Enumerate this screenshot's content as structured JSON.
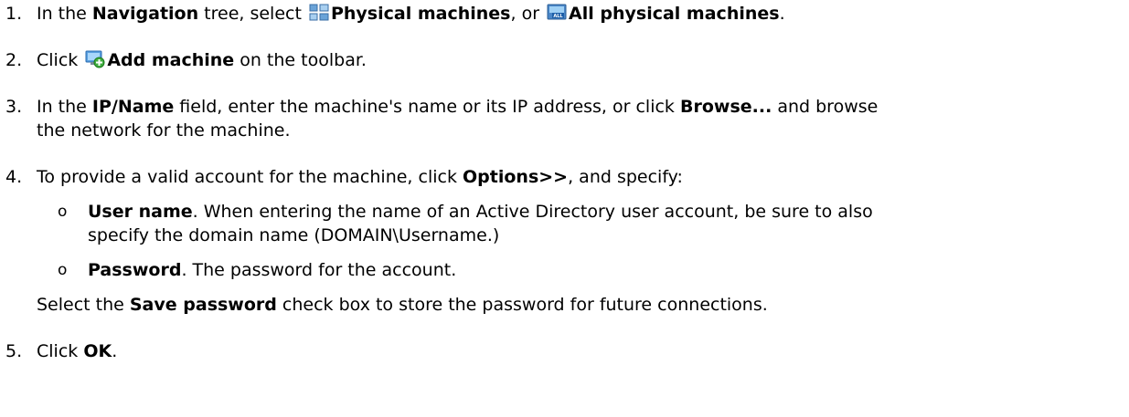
{
  "steps": [
    {
      "num": "1.",
      "p1": "In the ",
      "b1": "Navigation",
      "p2": " tree, select ",
      "b2": "Physical machines",
      "p3": ", or ",
      "b3": "All physical machines",
      "p4": "."
    },
    {
      "num": "2.",
      "p1": "Click ",
      "b1": "Add machine",
      "p2": " on the toolbar."
    },
    {
      "num": "3.",
      "p1": "In the ",
      "b1": "IP/Name",
      "p2": " field, enter the machine's name or its IP address, or click ",
      "b2": "Browse...",
      "p3": " and browse",
      "line2": "the network for the machine."
    },
    {
      "num": "4.",
      "p1": "To provide a valid account for the machine, click ",
      "b1": "Options>>",
      "p2": ", and specify:",
      "bullets": [
        {
          "marker": "o",
          "bold": "User name",
          "text": ". When entering the name of an Active Directory user account, be sure to also",
          "line2": "specify the domain name (DOMAIN\\Username.)"
        },
        {
          "marker": "o",
          "bold": "Password",
          "text": ". The password for the account."
        }
      ],
      "after_p1": "Select the ",
      "after_b1": "Save password",
      "after_p2": " check box to store the password for future connections."
    },
    {
      "num": "5.",
      "p1": "Click ",
      "b1": "OK",
      "p2": "."
    }
  ],
  "icons": {
    "physical_machines": "tree-grid-icon",
    "all_physical_machines": "all-machines-icon",
    "add_machine": "add-machine-icon"
  }
}
